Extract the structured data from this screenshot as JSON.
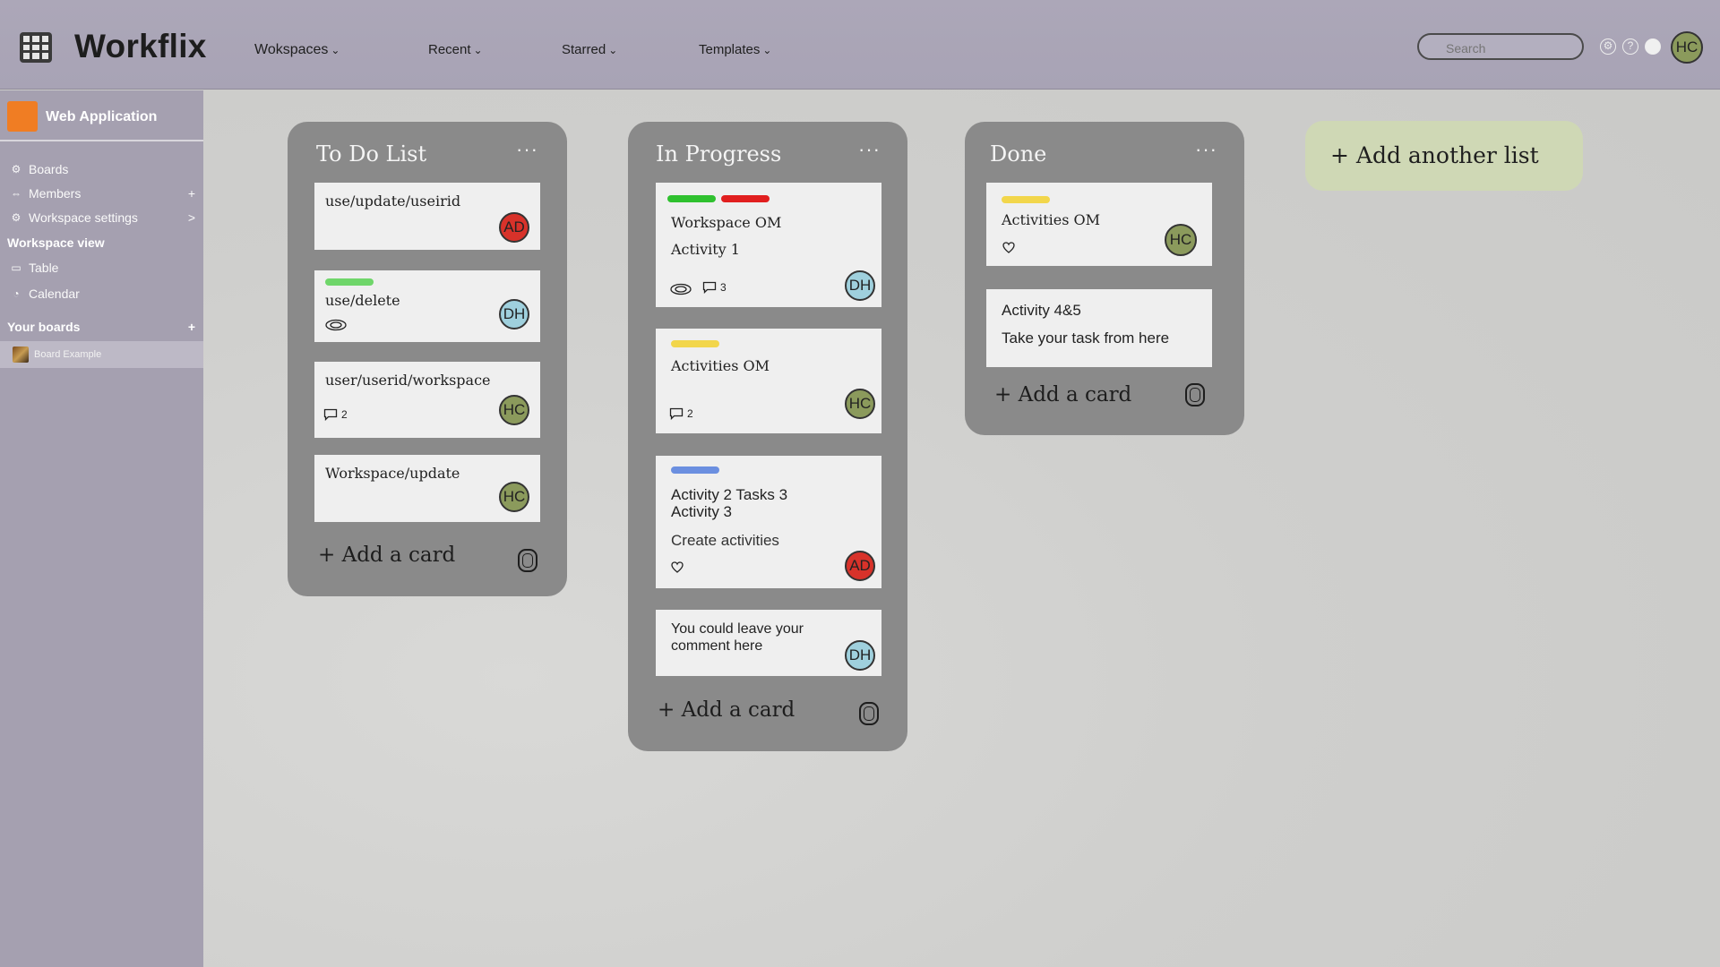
{
  "header": {
    "brand": "Workflix",
    "nav": [
      {
        "label": "Wokspaces",
        "chevron": "⌄"
      },
      {
        "label": "Recent",
        "chevron": "⌄"
      },
      {
        "label": "Starred",
        "chevron": "⌄"
      },
      {
        "label": "Templates",
        "chevron": "⌄"
      }
    ],
    "search_placeholder": "Search",
    "user_initials": "HC"
  },
  "sidebar": {
    "workspace_name": "Web Application",
    "items": [
      {
        "label": "Boards",
        "icon": "boards-icon",
        "right": ""
      },
      {
        "label": "Members",
        "icon": "members-icon",
        "right": "+"
      },
      {
        "label": "Workspace settings",
        "icon": "gear-icon",
        "right": ">"
      }
    ],
    "view_heading": "Workspace view",
    "views": [
      {
        "label": "Table",
        "icon": "table-icon"
      },
      {
        "label": "Calendar",
        "icon": "calendar-icon"
      }
    ],
    "boards_heading": "Your boards",
    "boards_add": "+",
    "boards": [
      {
        "label": "Board Example"
      }
    ]
  },
  "lists": [
    {
      "title": "To Do List",
      "menu": "···",
      "add_card": "+ Add a card",
      "cards": [
        {
          "text": "use/update/useirid",
          "avatar": "AD"
        },
        {
          "text": "use/delete",
          "avatar": "DH",
          "labels": [
            "#6fd66a"
          ],
          "watch": true
        },
        {
          "text": "user/userid/workspace",
          "avatar": "HC",
          "comments": "2"
        },
        {
          "text": "Workspace/update",
          "avatar": "HC"
        }
      ]
    },
    {
      "title": "In Progress",
      "menu": "···",
      "add_card": "+ Add a card",
      "cards": [
        {
          "line1": "Workspace OM",
          "line2": "Activity 1",
          "avatar": "DH",
          "labels": [
            "#2fc12f",
            "#e11f1f"
          ],
          "comments": "3",
          "watch": true
        },
        {
          "text": "Activities OM",
          "avatar": "HC",
          "labels": [
            "#f2d64b"
          ],
          "comments": "2"
        },
        {
          "line1": "Activity 2 Tasks 3",
          "line2": "Activity 3",
          "line3": "Create activities",
          "avatar": "AD",
          "labels": [
            "#6b8fe0"
          ],
          "heart": true
        },
        {
          "line1": "You could leave your",
          "line2": "comment here",
          "avatar": "DH"
        }
      ]
    },
    {
      "title": "Done",
      "menu": "···",
      "add_card": "+ Add a card",
      "cards": [
        {
          "text": "Activities OM",
          "avatar": "HC",
          "labels": [
            "#f2d64b"
          ],
          "heart": true
        },
        {
          "line1": "Activity 4&5",
          "line2": "Take your task from here"
        }
      ]
    }
  ],
  "add_list": "+ Add another list"
}
